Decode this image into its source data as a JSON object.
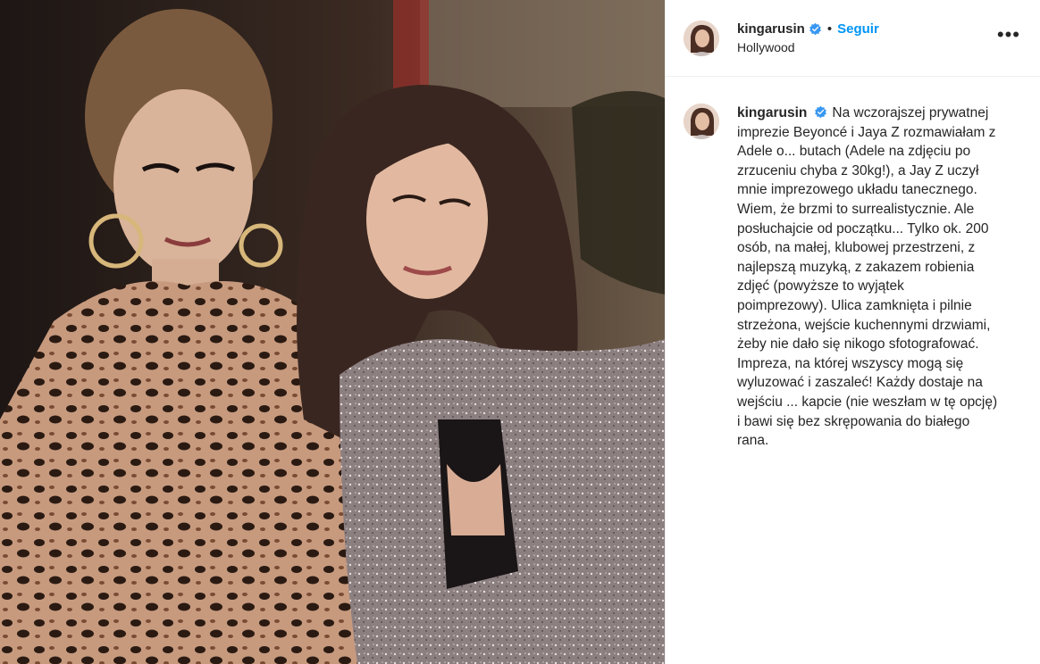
{
  "post": {
    "username": "kingarusin",
    "verified_icon": "verified-badge-icon",
    "separator": "•",
    "follow_label": "Seguir",
    "location": "Hollywood",
    "more_label": "•••",
    "caption": "Na wczorajszej prywatnej imprezie Beyoncé i Jaya Z rozmawiałam z Adele o... butach (Adele na zdjęciu po zrzuceniu chyba z 30kg!), a Jay Z uczył mnie imprezowego układu tanecznego. Wiem, że brzmi to surrealistycznie. Ale posłuchajcie od początku... Tylko ok. 200 osób, na małej,  klubowej przestrzeni, z najlepszą muzyką, z zakazem robienia zdjęć (powyższe to wyjątek poimprezowy). Ulica zamknięta i pilnie strzeżona, wejście kuchennymi drzwiami, żeby nie dało się nikogo sfotografować. Impreza, na której wszyscy mogą się wyluzować i zaszaleć! Każdy dostaje na wejściu ... kapcie (nie weszłam w tę opcję) i bawi się bez skrępowania do białego rana."
  },
  "colors": {
    "accent": "#0095f6",
    "text": "#262626",
    "border": "#efefef",
    "verified": "#3897f0"
  }
}
